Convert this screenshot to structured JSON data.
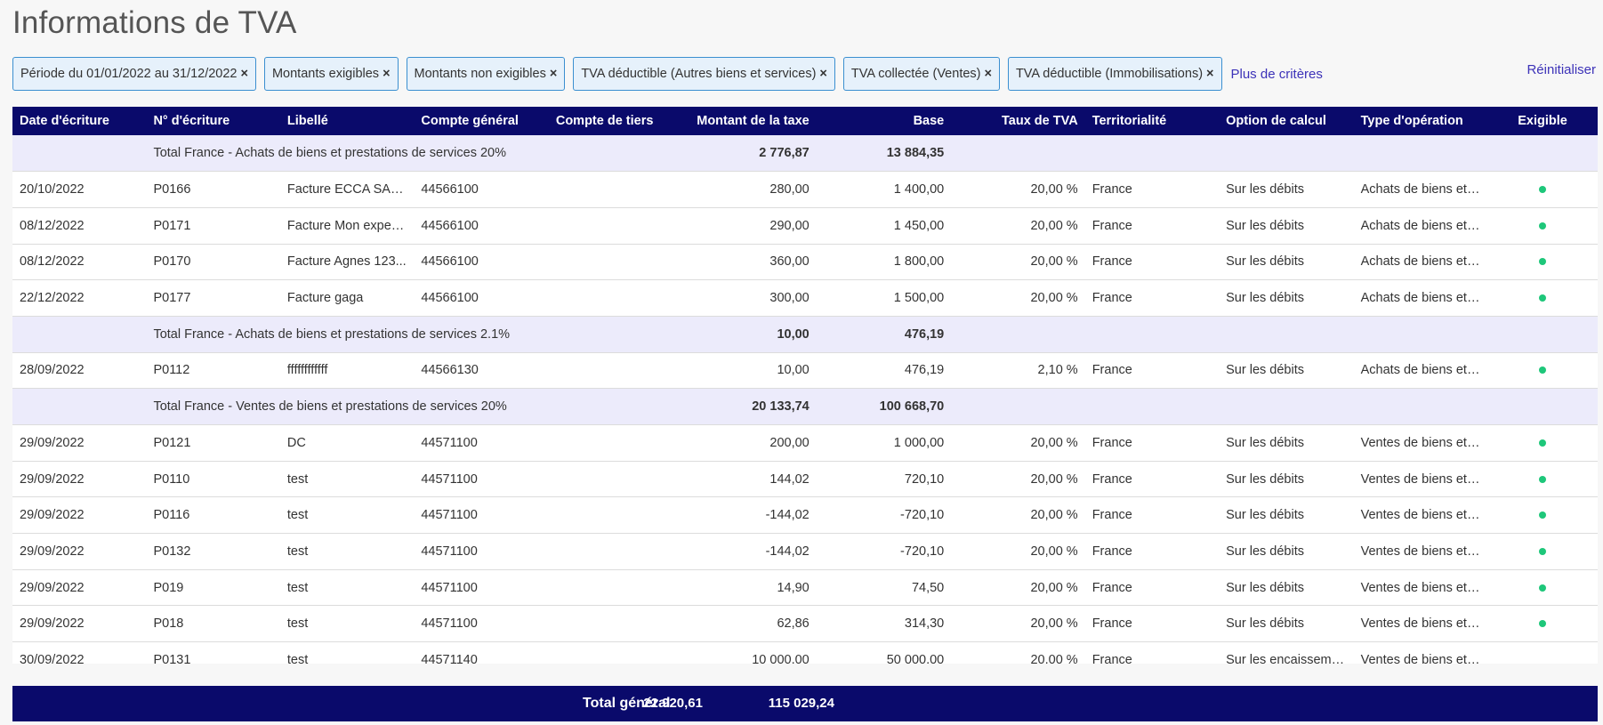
{
  "page": {
    "title": "Informations de TVA"
  },
  "filters": [
    {
      "label": "Période du 01/01/2022 au 31/12/2022"
    },
    {
      "label": "Montants exigibles"
    },
    {
      "label": "Montants non exigibles"
    },
    {
      "label": "TVA déductible (Autres biens et services)"
    },
    {
      "label": "TVA collectée (Ventes)"
    },
    {
      "label": "TVA déductible (Immobilisations)"
    }
  ],
  "filter_remove_glyph": "×",
  "more_criteria": "Plus de critères",
  "reset": "Réinitialiser",
  "table": {
    "columns": [
      "Date d'écriture",
      "N° d'écriture",
      "Libellé",
      "Compte général",
      "Compte de tiers",
      "Montant de la taxe",
      "Base",
      "Taux de TVA",
      "Territorialité",
      "Option de calcul",
      "Type d'opération",
      "Exigible"
    ],
    "rows": [
      {
        "type": "total",
        "label": "Total France - Achats de biens et prestations de services 20%",
        "tax": "2 776,87",
        "base": "13 884,35"
      },
      {
        "type": "row",
        "date": "20/10/2022",
        "num": "P0166",
        "libelle": "Facture ECCA SARL",
        "compte": "44566100",
        "tiers": "",
        "tax": "280,00",
        "base": "1 400,00",
        "taux": "20,00 %",
        "terr": "France",
        "option": "Sur les débits",
        "optype": "Achats de biens et ...",
        "exigible": true
      },
      {
        "type": "row",
        "date": "08/12/2022",
        "num": "P0171",
        "libelle": "Facture Mon expert...",
        "compte": "44566100",
        "tiers": "",
        "tax": "290,00",
        "base": "1 450,00",
        "taux": "20,00 %",
        "terr": "France",
        "option": "Sur les débits",
        "optype": "Achats de biens et ...",
        "exigible": true
      },
      {
        "type": "row",
        "date": "08/12/2022",
        "num": "P0170",
        "libelle": "Facture Agnes 123...",
        "compte": "44566100",
        "tiers": "",
        "tax": "360,00",
        "base": "1 800,00",
        "taux": "20,00 %",
        "terr": "France",
        "option": "Sur les débits",
        "optype": "Achats de biens et ...",
        "exigible": true
      },
      {
        "type": "row",
        "date": "22/12/2022",
        "num": "P0177",
        "libelle": "Facture gaga",
        "compte": "44566100",
        "tiers": "",
        "tax": "300,00",
        "base": "1 500,00",
        "taux": "20,00 %",
        "terr": "France",
        "option": "Sur les débits",
        "optype": "Achats de biens et ...",
        "exigible": true
      },
      {
        "type": "total",
        "label": "Total France - Achats de biens et prestations de services 2.1%",
        "tax": "10,00",
        "base": "476,19"
      },
      {
        "type": "row",
        "date": "28/09/2022",
        "num": "P0112",
        "libelle": "ffffffffffff",
        "compte": "44566130",
        "tiers": "",
        "tax": "10,00",
        "base": "476,19",
        "taux": "2,10 %",
        "terr": "France",
        "option": "Sur les débits",
        "optype": "Achats de biens et ...",
        "exigible": true
      },
      {
        "type": "total",
        "label": "Total France - Ventes de biens et prestations de services 20%",
        "tax": "20 133,74",
        "base": "100 668,70"
      },
      {
        "type": "row",
        "date": "29/09/2022",
        "num": "P0121",
        "libelle": "DC",
        "compte": "44571100",
        "tiers": "",
        "tax": "200,00",
        "base": "1 000,00",
        "taux": "20,00 %",
        "terr": "France",
        "option": "Sur les débits",
        "optype": "Ventes de biens et ...",
        "exigible": true
      },
      {
        "type": "row",
        "date": "29/09/2022",
        "num": "P0110",
        "libelle": "test",
        "compte": "44571100",
        "tiers": "",
        "tax": "144,02",
        "base": "720,10",
        "taux": "20,00 %",
        "terr": "France",
        "option": "Sur les débits",
        "optype": "Ventes de biens et ...",
        "exigible": true
      },
      {
        "type": "row",
        "date": "29/09/2022",
        "num": "P0116",
        "libelle": "test",
        "compte": "44571100",
        "tiers": "",
        "tax": "-144,02",
        "base": "-720,10",
        "taux": "20,00 %",
        "terr": "France",
        "option": "Sur les débits",
        "optype": "Ventes de biens et ...",
        "exigible": true
      },
      {
        "type": "row",
        "date": "29/09/2022",
        "num": "P0132",
        "libelle": "test",
        "compte": "44571100",
        "tiers": "",
        "tax": "-144,02",
        "base": "-720,10",
        "taux": "20,00 %",
        "terr": "France",
        "option": "Sur les débits",
        "optype": "Ventes de biens et ...",
        "exigible": true
      },
      {
        "type": "row",
        "date": "29/09/2022",
        "num": "P019",
        "libelle": "test",
        "compte": "44571100",
        "tiers": "",
        "tax": "14,90",
        "base": "74,50",
        "taux": "20,00 %",
        "terr": "France",
        "option": "Sur les débits",
        "optype": "Ventes de biens et ...",
        "exigible": true
      },
      {
        "type": "row",
        "date": "29/09/2022",
        "num": "P018",
        "libelle": "test",
        "compte": "44571100",
        "tiers": "",
        "tax": "62,86",
        "base": "314,30",
        "taux": "20,00 %",
        "terr": "France",
        "option": "Sur les débits",
        "optype": "Ventes de biens et ...",
        "exigible": true
      },
      {
        "type": "row",
        "date": "30/09/2022",
        "num": "P0131",
        "libelle": "test",
        "compte": "44571140",
        "tiers": "",
        "tax": "10 000,00",
        "base": "50 000,00",
        "taux": "20,00 %",
        "terr": "France",
        "option": "Sur les encaisseme...",
        "optype": "Ventes de biens et ...",
        "exigible": false
      }
    ]
  },
  "footer": {
    "label": "Total général",
    "tax": "22 920,61",
    "base": "115 029,24"
  },
  "colors": {
    "header_bg": "#0a0a6b",
    "total_row_bg": "#ecebfb",
    "chip_border": "#3b8fd0",
    "chip_bg": "#e6f1fb",
    "link": "#3c32b8",
    "exigible_dot": "#1ec77a"
  },
  "icons": {
    "exigible": "green-dot-icon",
    "remove_filter": "close-icon"
  }
}
